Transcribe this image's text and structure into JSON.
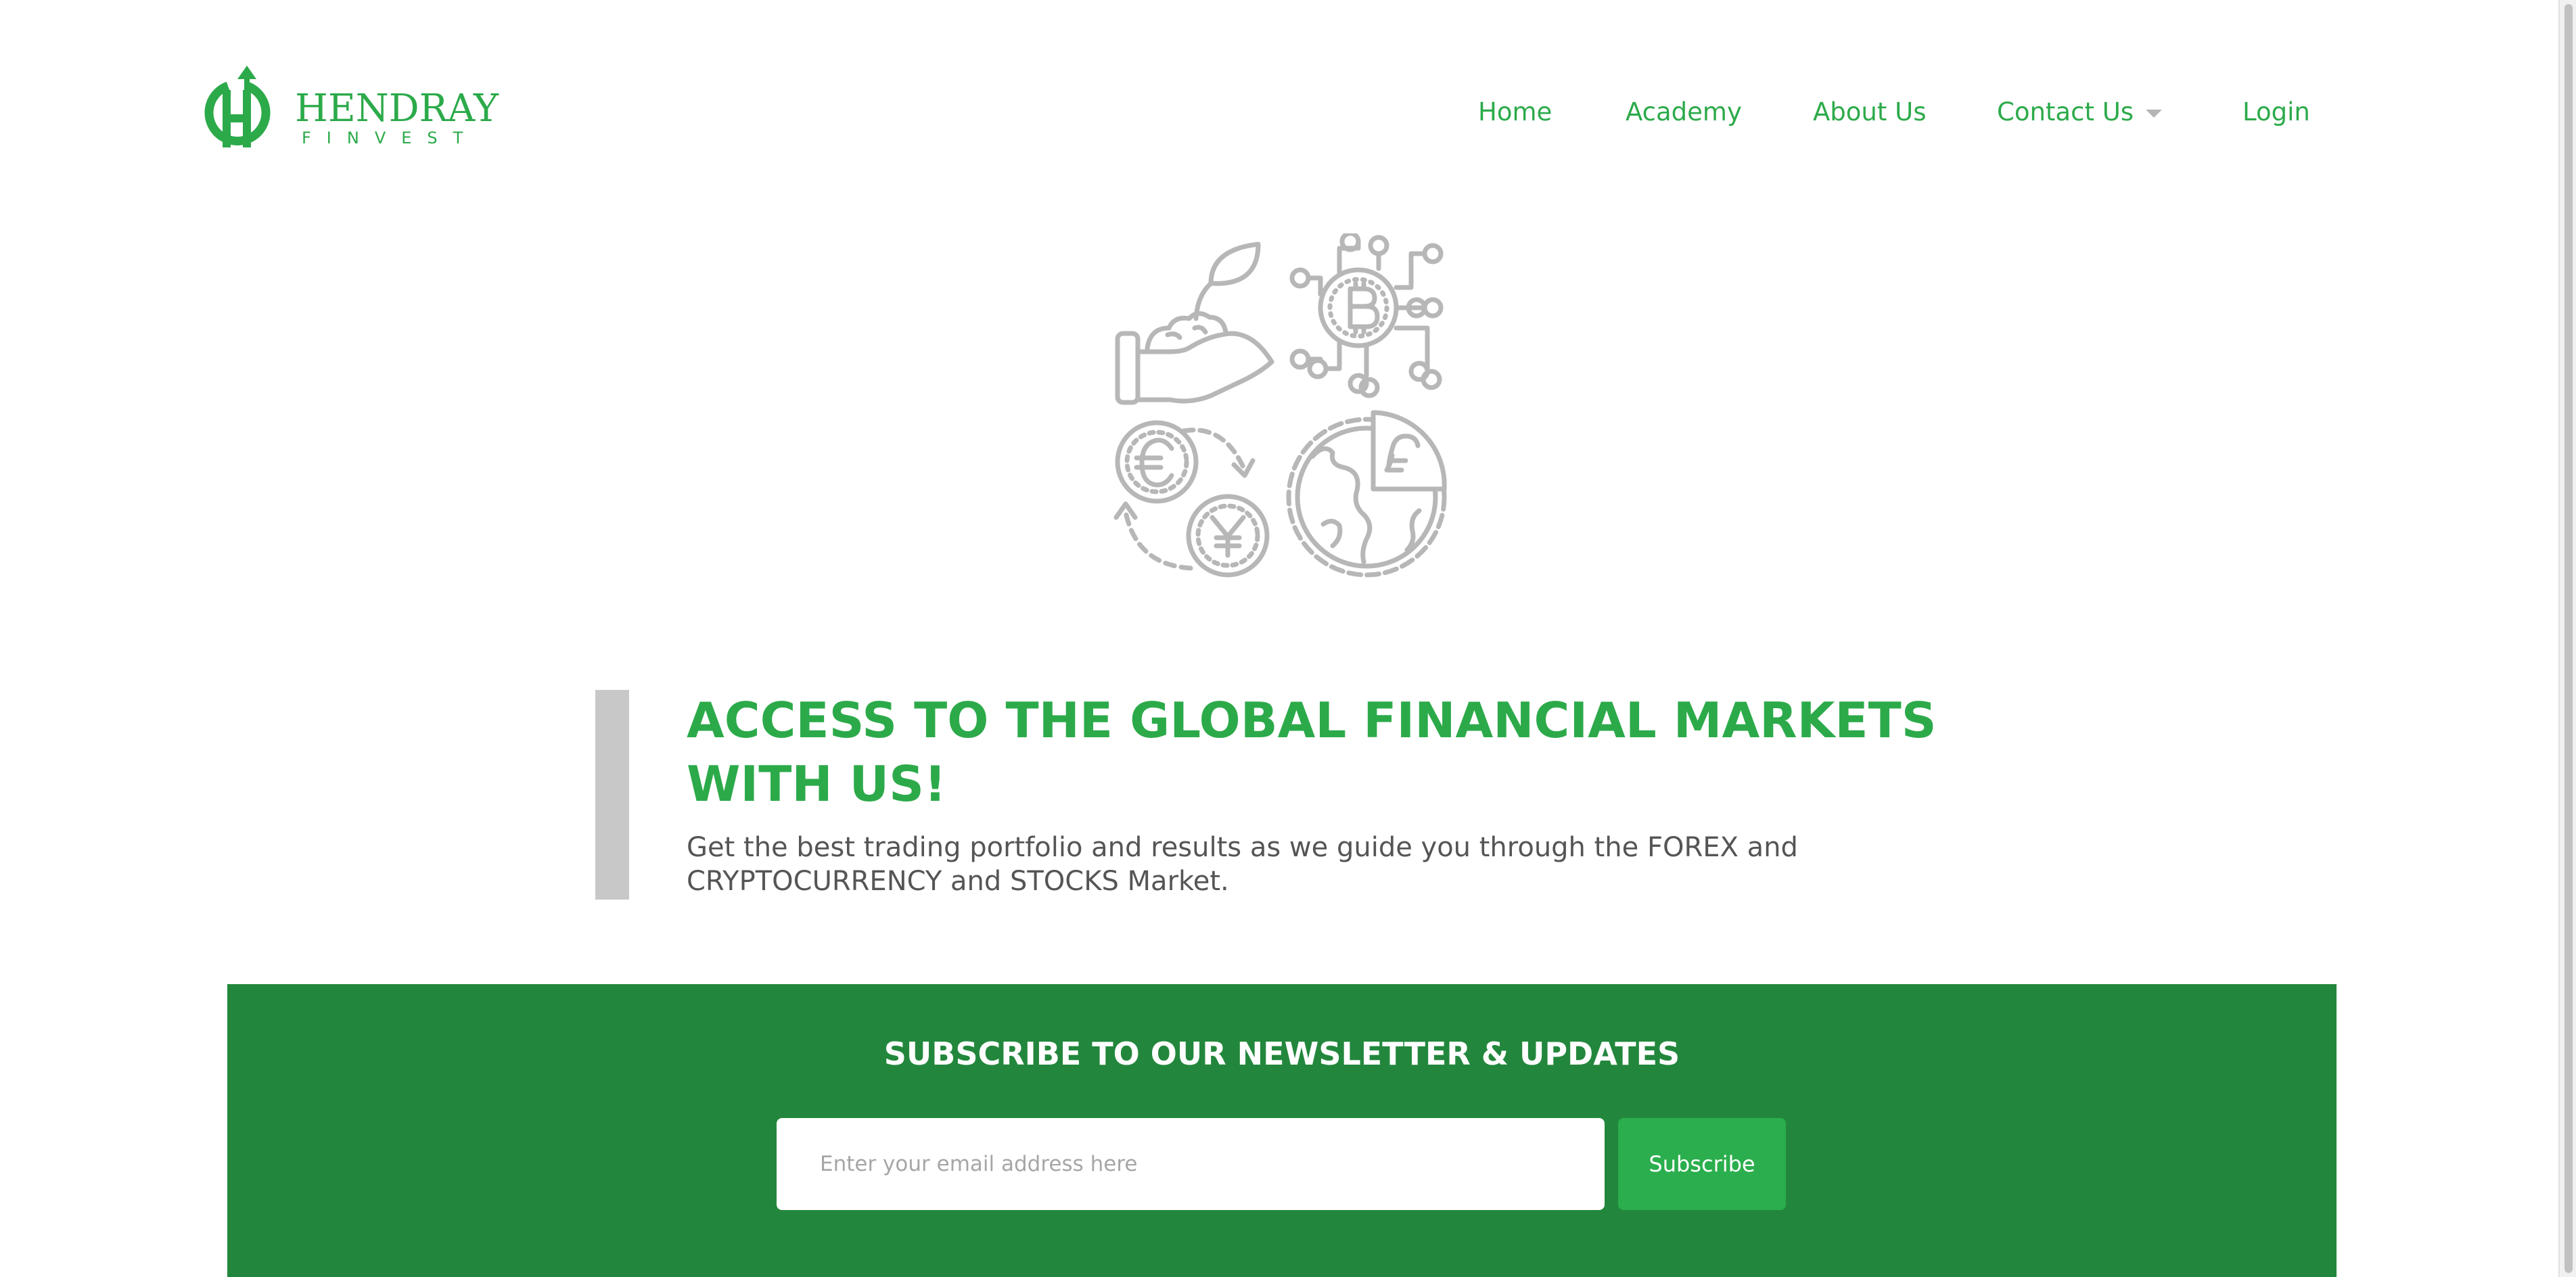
{
  "brand": {
    "name": "HENDRAY",
    "subtitle": "FINVEST",
    "color": "#2caa4a"
  },
  "nav": {
    "items": [
      {
        "label": "Home"
      },
      {
        "label": "Academy"
      },
      {
        "label": "About Us"
      },
      {
        "label": "Contact Us",
        "has_dropdown": true
      },
      {
        "label": "Login"
      }
    ]
  },
  "hero": {
    "illustration_icons": [
      "plant-in-hand-icon",
      "bitcoin-circuit-icon",
      "currency-exchange-icon",
      "globe-pie-chart-icon"
    ],
    "headline": "ACCESS TO THE GLOBAL FINANCIAL MARKETS WITH US!",
    "subtext": "Get the best trading portfolio and results as we guide you through the FOREX and CRYPTOCURRENCY and STOCKS Market."
  },
  "newsletter": {
    "title": "SUBSCRIBE TO OUR NEWSLETTER & UPDATES",
    "email_placeholder": "Enter your email address here",
    "email_value": "",
    "button_label": "Subscribe",
    "background": "#22873c",
    "button_color": "#2bae4d"
  }
}
